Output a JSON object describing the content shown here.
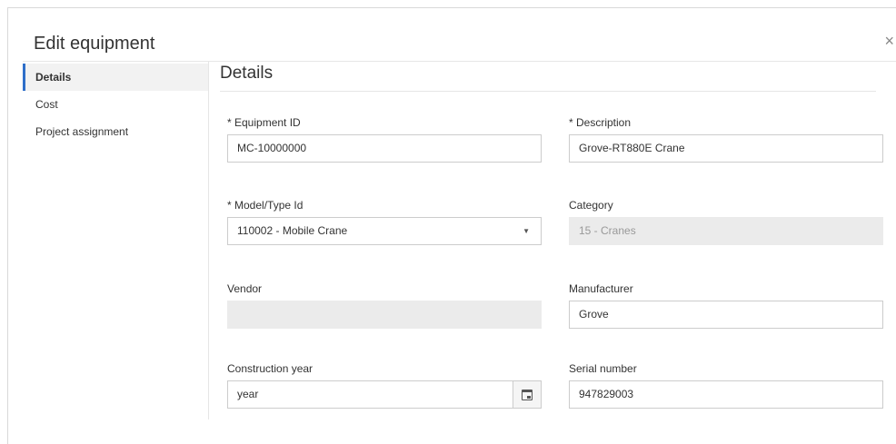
{
  "dialog": {
    "title": "Edit equipment",
    "close_label": "×"
  },
  "sidebar": {
    "items": [
      {
        "label": "Details",
        "active": true
      },
      {
        "label": "Cost",
        "active": false
      },
      {
        "label": "Project assignment",
        "active": false
      }
    ]
  },
  "main": {
    "section_title": "Details",
    "fields": {
      "equipment_id": {
        "label": "* Equipment ID",
        "value": "MC-10000000"
      },
      "description": {
        "label": "* Description",
        "value": "Grove-RT880E Crane"
      },
      "model_type": {
        "label": "* Model/Type Id",
        "value": "110002 - Mobile Crane",
        "arrow": "▼"
      },
      "category": {
        "label": "Category",
        "value": "15 - Cranes"
      },
      "vendor": {
        "label": "Vendor",
        "value": ""
      },
      "manufacturer": {
        "label": "Manufacturer",
        "value": "Grove"
      },
      "construction_year": {
        "label": "Construction year",
        "value": "year",
        "icon": "calendar-icon"
      },
      "serial_number": {
        "label": "Serial number",
        "value": "947829003"
      }
    }
  },
  "colors": {
    "accent": "#2f6fc9",
    "disabled_bg": "#ebebeb",
    "border": "#cccccc"
  }
}
